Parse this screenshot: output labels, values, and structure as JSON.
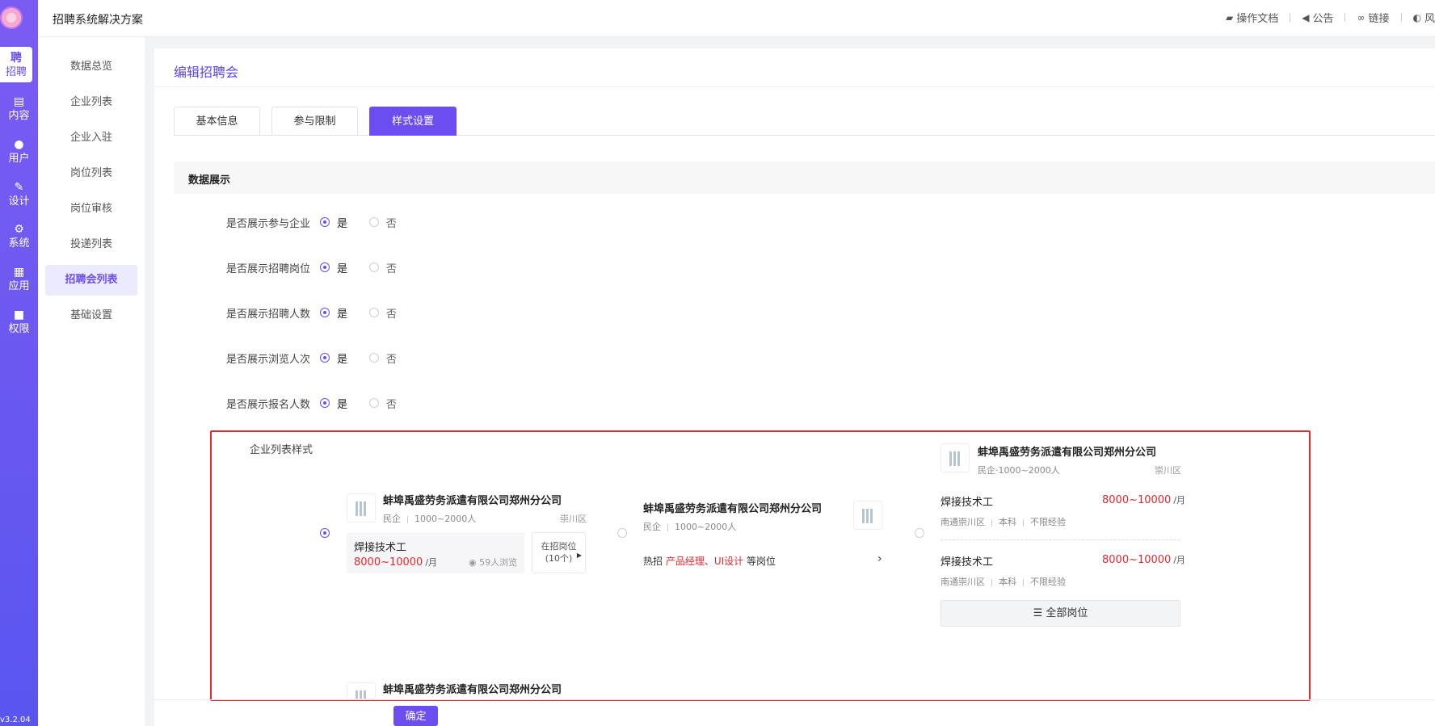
{
  "app": {
    "title": "招聘系统解决方案",
    "version": "v3.2.04"
  },
  "header": {
    "links": [
      {
        "icon": "folder-icon",
        "label": "操作文档"
      },
      {
        "icon": "megaphone-icon",
        "label": "公告"
      },
      {
        "icon": "paperclip-icon",
        "label": "链接"
      },
      {
        "icon": "palette-icon",
        "label": "风"
      }
    ]
  },
  "rail": {
    "items": [
      {
        "icon": "聘",
        "label": "招聘",
        "active": true
      },
      {
        "icon": "document-icon",
        "label": "内容"
      },
      {
        "icon": "user-icon",
        "label": "用户"
      },
      {
        "icon": "brush-icon",
        "label": "设计"
      },
      {
        "icon": "gear-icon",
        "label": "系统"
      },
      {
        "icon": "grid-icon",
        "label": "应用"
      },
      {
        "icon": "lock-icon",
        "label": "权限"
      }
    ]
  },
  "submenu": {
    "items": [
      "数据总览",
      "企业列表",
      "企业入驻",
      "岗位列表",
      "岗位审核",
      "投递列表",
      "招聘会列表",
      "基础设置"
    ],
    "active_index": 6
  },
  "main": {
    "page_title": "编辑招聘会",
    "tabs": [
      "基本信息",
      "参与限制",
      "样式设置"
    ],
    "active_tab": 2,
    "section_title": "数据展示",
    "yes": "是",
    "no": "否",
    "options": [
      {
        "label": "是否展示参与企业",
        "value": "是"
      },
      {
        "label": "是否展示招聘岗位",
        "value": "是"
      },
      {
        "label": "是否展示招聘人数",
        "value": "是"
      },
      {
        "label": "是否展示浏览人次",
        "value": "是"
      },
      {
        "label": "是否展示报名人数",
        "value": "是"
      }
    ],
    "style_label": "企业列表样式",
    "selected_style": 1,
    "confirm_label": "确定"
  },
  "company": {
    "name": "蚌埠禹盛劳务派遣有限公司郑州分公司",
    "type": "民企",
    "size": "1000~2000人",
    "type_size": "民企·1000~2000人",
    "district": "崇川区",
    "job": "焊接技术工",
    "salary": "8000~10000",
    "salary_unit": "/月",
    "views": "59人浏览",
    "open_label": "在招岗位",
    "open_count": "(10个)",
    "hot_prefix": "热招",
    "hot_jobs": "产品经理、UI设计",
    "hot_suffix": "等岗位",
    "job_meta": [
      "南通崇川区",
      "本科",
      "不限经验"
    ],
    "all_jobs": "全部岗位"
  }
}
